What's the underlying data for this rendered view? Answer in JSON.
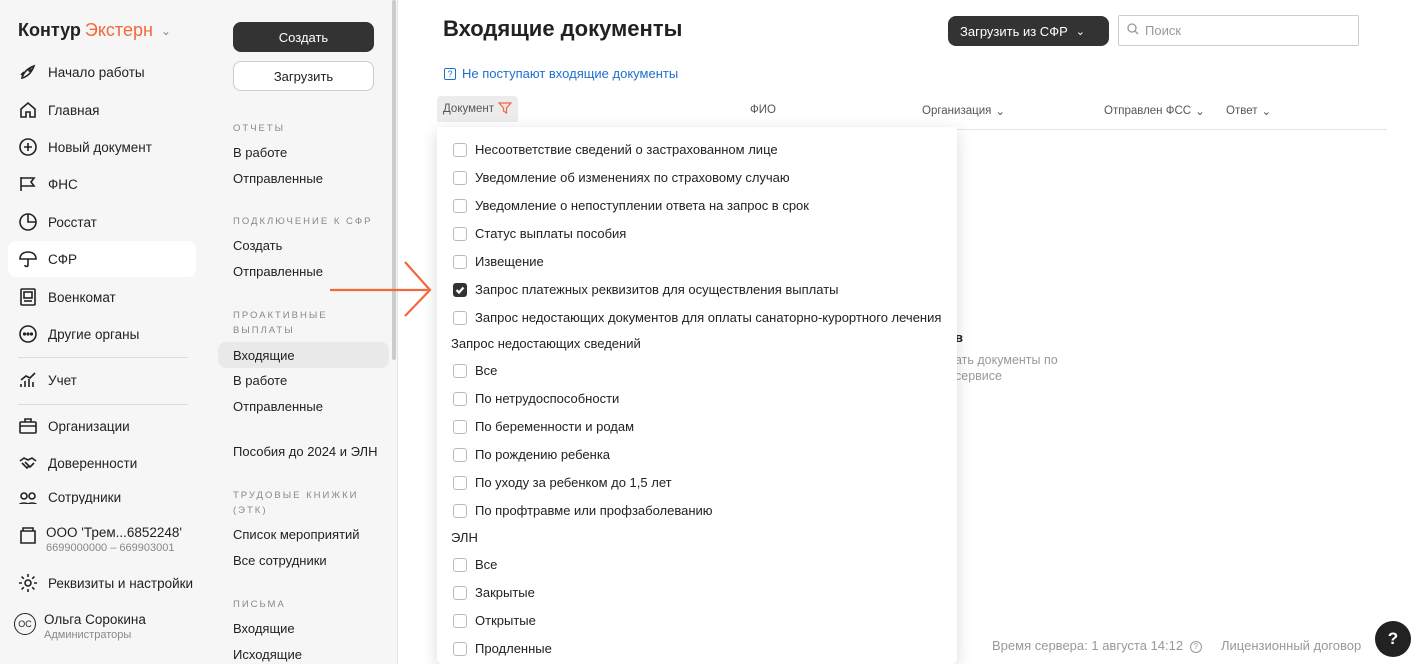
{
  "sidebar": {
    "logo_brand": "Контур",
    "logo_product": "Экстерн",
    "items": [
      {
        "label": "Начало работы",
        "icon": "rocket-icon"
      },
      {
        "label": "Главная",
        "icon": "home-icon"
      },
      {
        "label": "Новый документ",
        "icon": "plus-circle-icon"
      },
      {
        "label": "ФНС",
        "icon": "flag-icon"
      },
      {
        "label": "Росстат",
        "icon": "pie-chart-icon"
      },
      {
        "label": "СФР",
        "icon": "umbrella-icon",
        "active": true
      },
      {
        "label": "Военкомат",
        "icon": "id-card-icon"
      },
      {
        "label": "Другие органы",
        "icon": "more-circle-icon"
      },
      {
        "label": "Учет",
        "icon": "chart-growth-icon"
      },
      {
        "label": "Организации",
        "icon": "briefcase-icon"
      },
      {
        "label": "Доверенности",
        "icon": "handshake-icon"
      },
      {
        "label": "Сотрудники",
        "icon": "people-icon"
      }
    ],
    "org": {
      "name": "ООО 'Трем...6852248'",
      "sub": "6699000000 – 669903001",
      "icon": "building-icon"
    },
    "settings": {
      "label": "Реквизиты и настройки",
      "icon": "gear-icon"
    },
    "user": {
      "initials": "ОС",
      "name": "Ольга Сорокина",
      "role": "Администраторы"
    }
  },
  "col2": {
    "create_label": "Создать",
    "upload_label": "Загрузить",
    "sections": [
      {
        "title": "ОТЧЕТЫ",
        "items": [
          "В работе",
          "Отправленные"
        ]
      },
      {
        "title": "ПОДКЛЮЧЕНИЕ К СФР",
        "items": [
          "Создать",
          "Отправленные"
        ]
      },
      {
        "title": "ПРОАКТИВНЫЕ ВЫПЛАТЫ",
        "items": [
          "Входящие",
          "В работе",
          "Отправленные"
        ]
      },
      {
        "title": "",
        "items": [
          "Пособия до 2024 и ЭЛН"
        ]
      },
      {
        "title": "ТРУДОВЫЕ КНИЖКИ (ЭТК)",
        "items": [
          "Список мероприятий",
          "Все сотрудники"
        ]
      },
      {
        "title": "ПИСЬМА",
        "items": [
          "Входящие",
          "Исходящие"
        ]
      }
    ]
  },
  "main": {
    "title": "Входящие документы",
    "sfr_button": "Загрузить из СФР",
    "search_placeholder": "Поиск",
    "help_link": "Не поступают входящие документы",
    "columns": {
      "doc": "Документ",
      "fio": "ФИО",
      "org": "Организация",
      "sent": "Отправлен ФСС",
      "answer": "Ответ"
    },
    "empty_title": "в",
    "empty_sub_1": "ать документы по",
    "empty_sub_2": "сервисе",
    "footer_time": "Время сервера: 1 августа 14:12",
    "footer_license": "Лицензионный договор",
    "help_fab": "?"
  },
  "dropdown": {
    "options_top": [
      {
        "label": "Несоответствие сведений о застрахованном лице",
        "checked": false
      },
      {
        "label": "Уведомление об изменениях по страховому случаю",
        "checked": false
      },
      {
        "label": "Уведомление о непоступлении ответа на запрос в срок",
        "checked": false
      },
      {
        "label": "Статус выплаты пособия",
        "checked": false
      },
      {
        "label": "Извещение",
        "checked": false
      },
      {
        "label": "Запрос платежных реквизитов для осуществления выплаты",
        "checked": true
      },
      {
        "label": "Запрос недостающих документов для оплаты санаторно-курортного лечения",
        "checked": false
      }
    ],
    "group1_label": "Запрос недостающих сведений",
    "group1": [
      {
        "label": "Все",
        "checked": false
      },
      {
        "label": "По нетрудоспособности",
        "checked": false
      },
      {
        "label": "По беременности и родам",
        "checked": false
      },
      {
        "label": "По рождению ребенка",
        "checked": false
      },
      {
        "label": "По уходу за ребенком до 1,5 лет",
        "checked": false
      },
      {
        "label": "По профтравме или профзаболеванию",
        "checked": false
      }
    ],
    "group2_label": "ЭЛН",
    "group2": [
      {
        "label": "Все",
        "checked": false
      },
      {
        "label": "Закрытые",
        "checked": false
      },
      {
        "label": "Открытые",
        "checked": false
      },
      {
        "label": "Продленные",
        "checked": false
      }
    ]
  },
  "colors": {
    "accent": "#f2683a",
    "link": "#1f6fcf",
    "dark": "#333333"
  }
}
